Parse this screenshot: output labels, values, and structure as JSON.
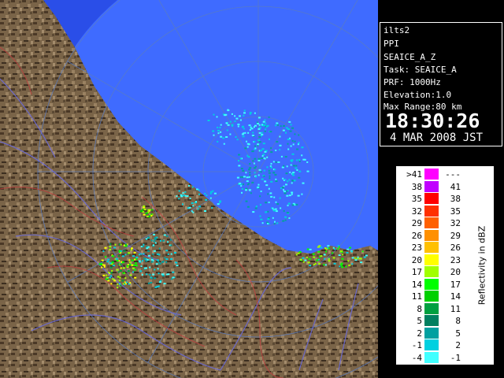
{
  "info": {
    "station": "ilts2",
    "product": "PPI",
    "product_name": "SEAICE_A_Z",
    "task": "Task: SEAICE_A",
    "prf": "PRF: 1000Hz",
    "elevation": "Elevation:1.0",
    "max_range": "Max Range:80 km",
    "time": "18:30:26",
    "date": "4 MAR 2008 JST"
  },
  "legend": {
    "title": "Reflectivity in dBZ",
    "rows": [
      {
        "lo": ">41",
        "hi": "---",
        "color": "#ff00ff"
      },
      {
        "lo": "38",
        "hi": "41",
        "color": "#c000ff"
      },
      {
        "lo": "35",
        "hi": "38",
        "color": "#ff0000"
      },
      {
        "lo": "32",
        "hi": "35",
        "color": "#ff3000"
      },
      {
        "lo": "29",
        "hi": "32",
        "color": "#ff6000"
      },
      {
        "lo": "26",
        "hi": "29",
        "color": "#ff9000"
      },
      {
        "lo": "23",
        "hi": "26",
        "color": "#ffc000"
      },
      {
        "lo": "20",
        "hi": "23",
        "color": "#ffff00"
      },
      {
        "lo": "17",
        "hi": "20",
        "color": "#a0ff00"
      },
      {
        "lo": "14",
        "hi": "17",
        "color": "#00ff00"
      },
      {
        "lo": "11",
        "hi": "14",
        "color": "#00d000"
      },
      {
        "lo": "8",
        "hi": "11",
        "color": "#00a040"
      },
      {
        "lo": "5",
        "hi": "8",
        "color": "#008060"
      },
      {
        "lo": "2",
        "hi": "5",
        "color": "#00a0a0"
      },
      {
        "lo": "-1",
        "hi": "2",
        "color": "#00d0e0"
      },
      {
        "lo": "-4",
        "hi": "-1",
        "color": "#40ffff"
      }
    ]
  },
  "colors": {
    "sea": "#2a4ee8",
    "range_disk": "#3f6bff",
    "land": "#7a6448",
    "rivers": "#6a6ad8",
    "boundaries": "#c04040"
  }
}
